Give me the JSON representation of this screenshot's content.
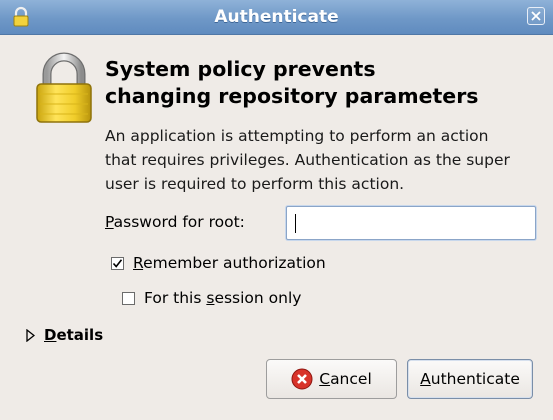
{
  "window": {
    "title": "Authenticate",
    "icon": "lock-icon",
    "close_icon": "close-icon"
  },
  "dialog": {
    "heading_line1": "System policy prevents",
    "heading_line2": "changing repository parameters",
    "description": [
      "An application is attempting to perform an action",
      "that requires privileges. Authentication as the super",
      "user is required to perform this action."
    ]
  },
  "password": {
    "label_mnemonic": "P",
    "label_rest": "assword for root:",
    "value": ""
  },
  "remember": {
    "mnemonic": "R",
    "label_rest": "emember authorization",
    "checked": true
  },
  "session_only": {
    "label_before": "For this ",
    "mnemonic": "s",
    "label_after": "ession only",
    "checked": false
  },
  "details": {
    "mnemonic": "D",
    "label_rest": "etails",
    "expanded": false
  },
  "buttons": {
    "cancel_mnemonic": "C",
    "cancel_rest": "ancel",
    "auth_mnemonic": "A",
    "auth_rest": "uthenticate"
  },
  "colors": {
    "titlebar": "#6f98c7",
    "background": "#efebe7",
    "lock_gold": "#e6c21f"
  }
}
